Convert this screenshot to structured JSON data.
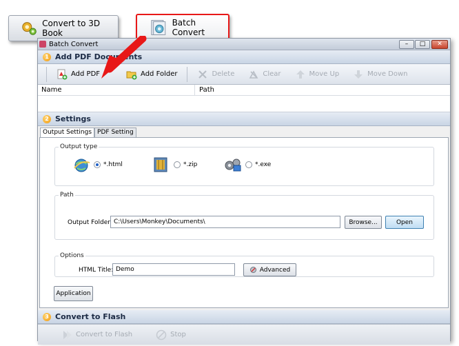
{
  "top_buttons": {
    "convert_3d": "Convert to 3D Book",
    "batch_convert": "Batch Convert"
  },
  "window": {
    "title": "Batch Convert",
    "controls": {
      "minimize": "–",
      "maximize": "□",
      "close": "✕"
    }
  },
  "section1": {
    "number": "1",
    "title": "Add PDF Documents"
  },
  "toolbar": {
    "add_pdf": "Add PDF",
    "add_folder": "Add Folder",
    "delete": "Delete",
    "clear": "Clear",
    "move_up": "Move Up",
    "move_down": "Move Down"
  },
  "list": {
    "columns": [
      "Name",
      "Path"
    ]
  },
  "section2": {
    "number": "2",
    "title": "Settings"
  },
  "tabs": [
    "Output Settings",
    "PDF Setting"
  ],
  "output_type": {
    "legend": "Output type",
    "options": [
      {
        "label": "*.html",
        "checked": true
      },
      {
        "label": "*.zip",
        "checked": false
      },
      {
        "label": "*.exe",
        "checked": false
      }
    ]
  },
  "path_group": {
    "legend": "Path",
    "output_folder_label": "Output Folder:",
    "output_folder_value": "C:\\Users\\Monkey\\Documents\\",
    "browse": "Browse...",
    "open": "Open"
  },
  "options_group": {
    "legend": "Options",
    "html_title_label": "HTML Title:",
    "html_title_value": "Demo",
    "advanced": "Advanced"
  },
  "application_button": "Application",
  "section3": {
    "number": "3",
    "title": "Convert to Flash"
  },
  "bottom_toolbar": {
    "convert": "Convert to Flash",
    "stop": "Stop"
  },
  "colors": {
    "accent_red": "#e81818",
    "badge_orange": "#f19a10"
  }
}
